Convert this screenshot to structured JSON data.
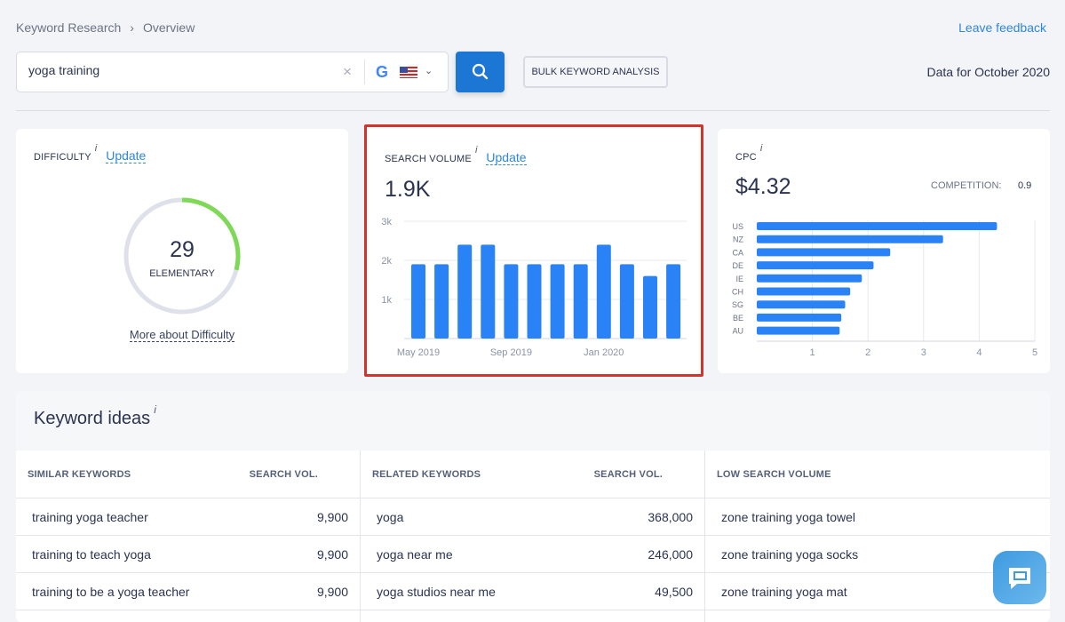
{
  "breadcrumb": [
    "Keyword Research",
    "Overview"
  ],
  "feedback": "Leave feedback",
  "search": {
    "value": "yoga training",
    "engine": "google-icon",
    "country": "us-flag-icon"
  },
  "bulk": "BULK KEYWORD ANALYSIS",
  "data_for": "Data for October 2020",
  "difficulty": {
    "title": "DIFFICULTY",
    "info": "i",
    "update": "Update",
    "value": "29",
    "level": "ELEMENTARY",
    "score": 29,
    "more": "More about Difficulty",
    "color": "#7ed957"
  },
  "volume": {
    "title": "SEARCH VOLUME",
    "info": "i",
    "update": "Update",
    "value": "1.9K"
  },
  "cpc": {
    "title": "CPC",
    "info": "i",
    "value": "$4.32",
    "competition_label": "COMPETITION:",
    "competition": "0.9"
  },
  "chart_data": [
    {
      "type": "bar",
      "categories": [
        "May 2019",
        "Jun 2019",
        "Jul 2019",
        "Aug 2019",
        "Sep 2019",
        "Oct 2019",
        "Nov 2019",
        "Dec 2019",
        "Jan 2020",
        "Feb 2020",
        "Mar 2020",
        "Apr 2020"
      ],
      "values": [
        1900,
        1900,
        2400,
        2400,
        1900,
        1900,
        1900,
        1900,
        2400,
        1900,
        1600,
        1900
      ],
      "ylim": [
        0,
        3000
      ],
      "yticks": [
        "1k",
        "2k",
        "3k"
      ],
      "xticks": [
        "May 2019",
        "Sep 2019",
        "Jan 2020"
      ],
      "grid": true,
      "color": "#2a82f7"
    },
    {
      "type": "bar",
      "orientation": "horizontal",
      "categories": [
        "US",
        "NZ",
        "CA",
        "DE",
        "IE",
        "CH",
        "SG",
        "BE",
        "AU"
      ],
      "values": [
        4.32,
        3.35,
        2.4,
        2.1,
        1.89,
        1.68,
        1.59,
        1.52,
        1.49
      ],
      "xlim": [
        0,
        5
      ],
      "xticks": [
        "1",
        "2",
        "3",
        "4",
        "5"
      ],
      "grid": true,
      "color": "#2a82f7"
    }
  ],
  "ideas": {
    "title": "Keyword ideas",
    "info": "i",
    "headers": [
      "SIMILAR KEYWORDS",
      "SEARCH VOL.",
      "RELATED KEYWORDS",
      "SEARCH VOL.",
      "LOW SEARCH VOLUME"
    ],
    "rows": [
      [
        "training yoga teacher",
        "9,900",
        "yoga",
        "368,000",
        "zone training yoga towel"
      ],
      [
        "training to teach yoga",
        "9,900",
        "yoga near me",
        "246,000",
        "zone training yoga socks"
      ],
      [
        "training to be a yoga teacher",
        "9,900",
        "yoga studios near me",
        "49,500",
        "zone training yoga mat"
      ]
    ]
  },
  "colors": {
    "accent": "#1c76d4",
    "highlight": "#d0342c",
    "bar": "#2a82f7"
  }
}
